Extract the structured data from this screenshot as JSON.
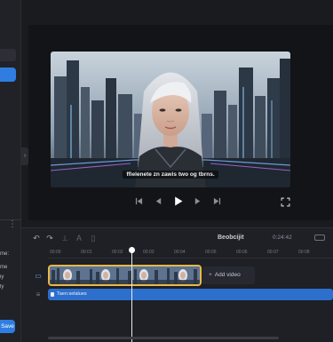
{
  "left_panel": {
    "text_lines": [
      "me:",
      "me",
      "iy",
      "ly"
    ],
    "more_label": "⋮",
    "save_label": "Save"
  },
  "player": {
    "subtitle": "ffielenete zn zawis two og tbrns."
  },
  "timeline": {
    "project_title": "Beobcijit",
    "time_display": "0:24:42",
    "ruler_labels": [
      "00:00",
      "00:01",
      "00:02",
      "00:03",
      "00:04",
      "00:05",
      "00:06",
      "00:07",
      "00:08"
    ],
    "add_video_label": "Add video",
    "subtitle_track_label": "Taen:selalues"
  },
  "colors": {
    "accent": "#2f7de1",
    "clip_border": "#e8b84a",
    "subtitle_track": "#2d6fcc"
  }
}
